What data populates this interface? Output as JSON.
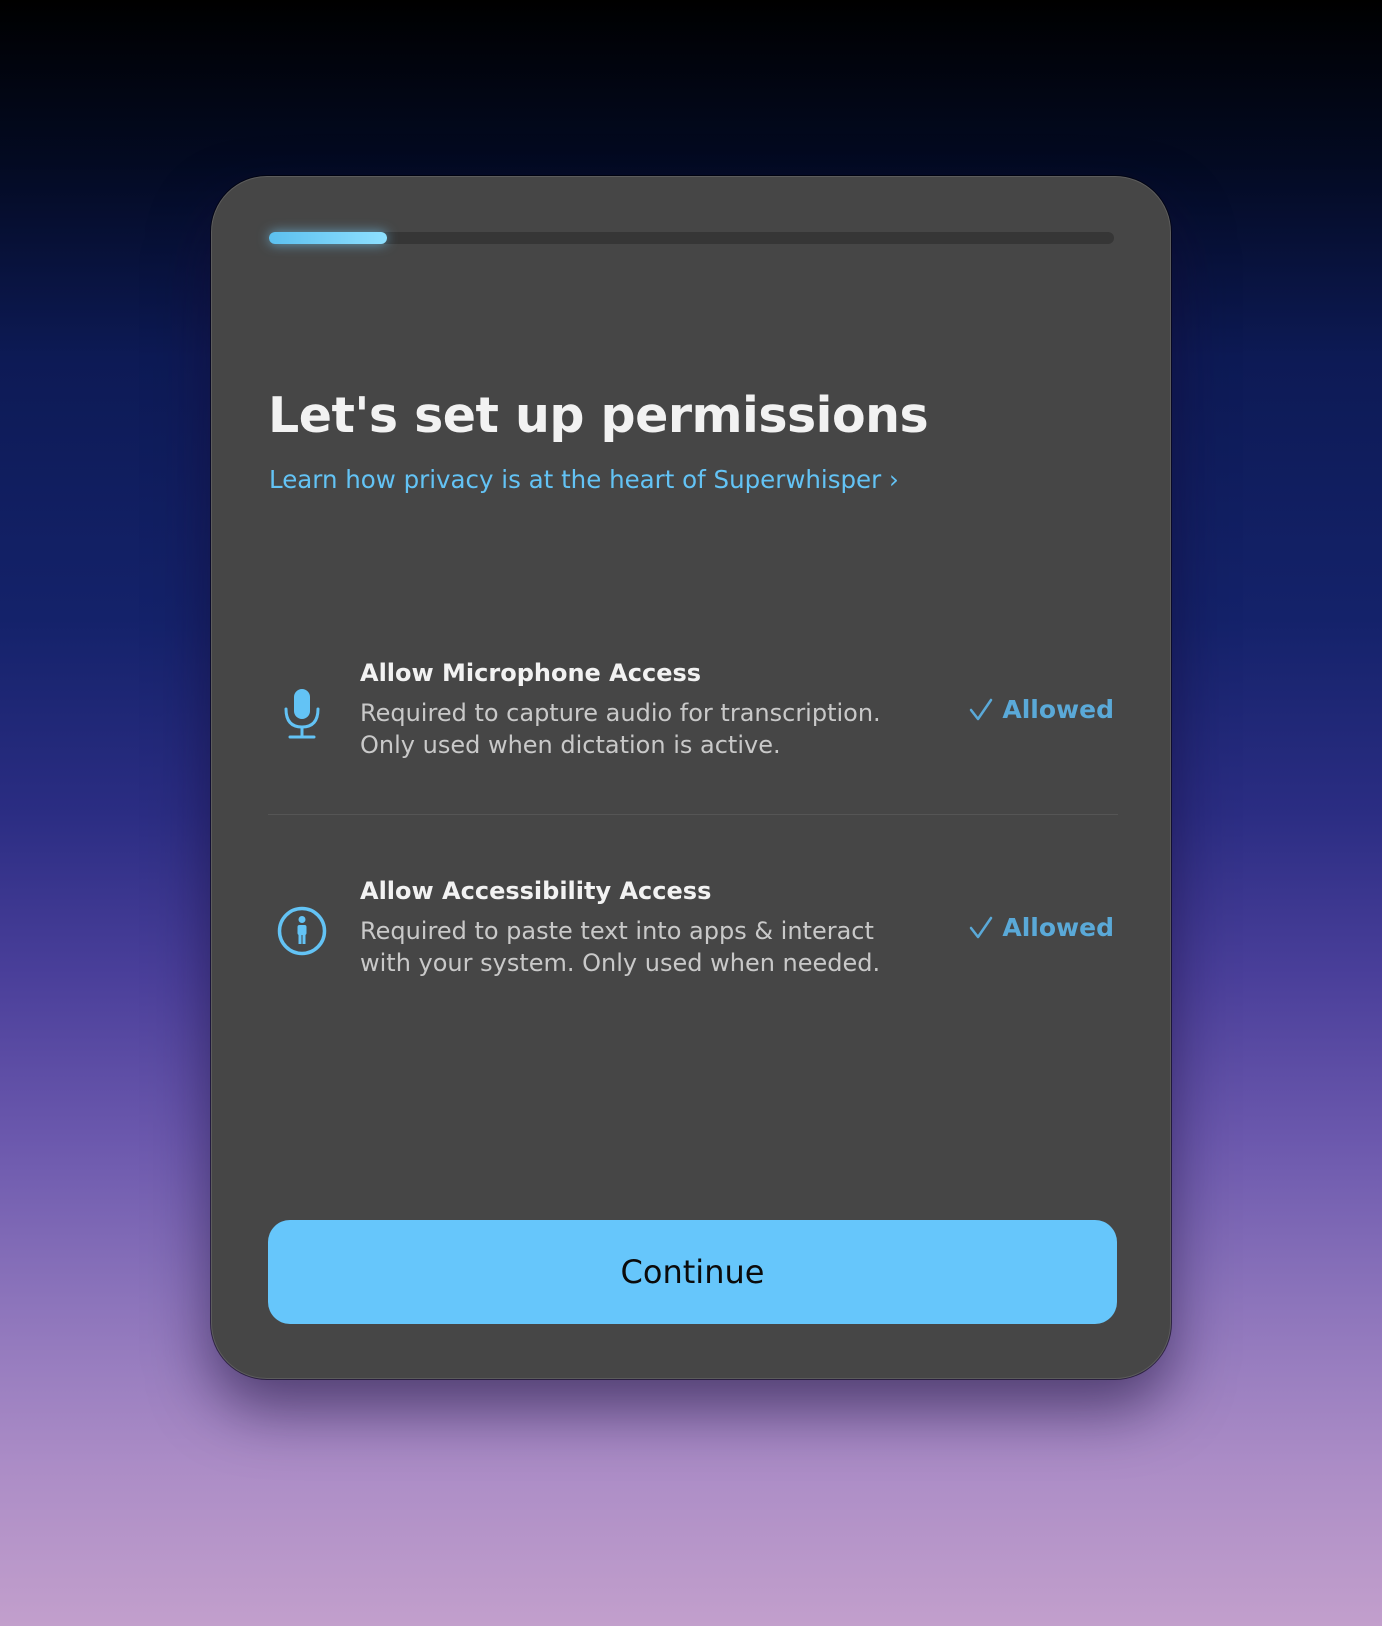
{
  "progress": {
    "value": 0.14,
    "color": "#6fd2fb"
  },
  "header": {
    "title": "Let's set up permissions",
    "privacy_link": "Learn how privacy is at the heart of Superwhisper ›"
  },
  "permissions": [
    {
      "icon": "microphone-icon",
      "title": "Allow Microphone Access",
      "description": "Required to capture audio for transcription. Only used when dictation is active.",
      "status": "Allowed"
    },
    {
      "icon": "accessibility-icon",
      "title": "Allow Accessibility Access",
      "description": "Required to paste text into apps & interact with your system. Only used when needed.",
      "status": "Allowed"
    }
  ],
  "footer": {
    "continue_label": "Continue"
  },
  "colors": {
    "accent": "#66c6fb",
    "link": "#63c3f5",
    "status": "#5aa9d8",
    "panel": "#464646"
  }
}
